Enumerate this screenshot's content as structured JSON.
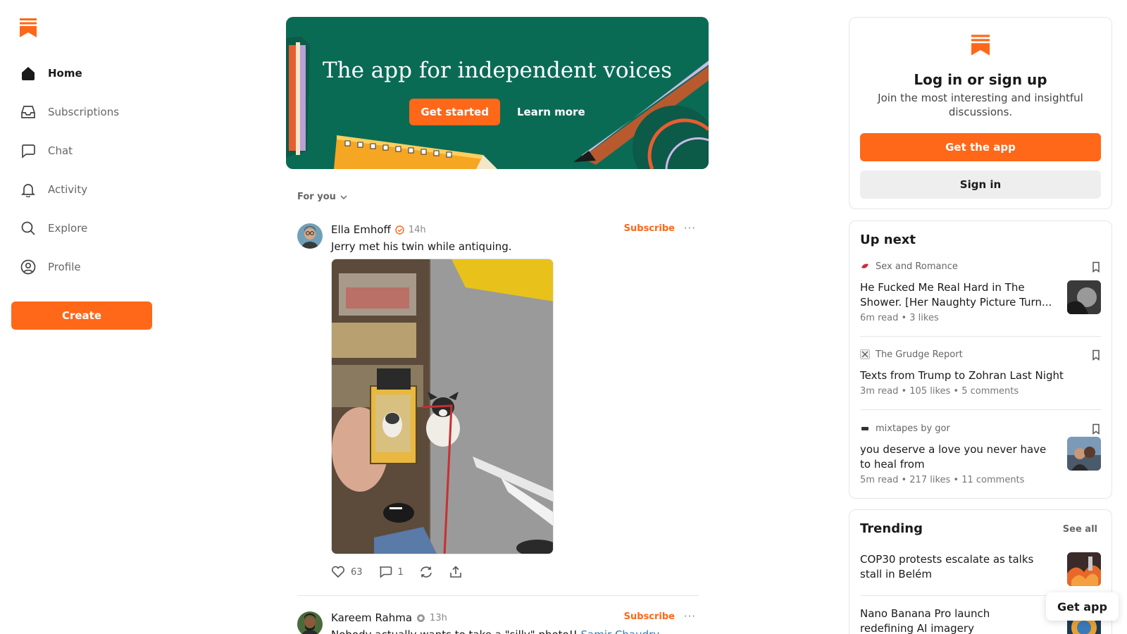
{
  "brand": {
    "accent": "#ff6719",
    "hero_bg": "#0a6b55"
  },
  "sidebar": {
    "items": [
      {
        "label": "Home",
        "icon": "home-icon",
        "active": true
      },
      {
        "label": "Subscriptions",
        "icon": "inbox-icon"
      },
      {
        "label": "Chat",
        "icon": "chat-icon"
      },
      {
        "label": "Activity",
        "icon": "bell-icon"
      },
      {
        "label": "Explore",
        "icon": "search-icon"
      },
      {
        "label": "Profile",
        "icon": "profile-icon"
      }
    ],
    "create_label": "Create"
  },
  "hero": {
    "title": "The app for independent voices",
    "primary_label": "Get started",
    "secondary_label": "Learn more"
  },
  "feed": {
    "filter_label": "For you",
    "posts": [
      {
        "author": "Ella Emhoff",
        "time": "14h",
        "subscribe_label": "Subscribe",
        "text": "Jerry met his twin while antiquing.",
        "likes": "63",
        "comments": "1"
      },
      {
        "author": "Kareem Rahma",
        "time": "13h",
        "subscribe_label": "Subscribe",
        "text": "Nobody actually wants to take a \"silly\" photo!! ",
        "mention": "Samir Chaudry"
      }
    ]
  },
  "login": {
    "title": "Log in or sign up",
    "subtitle": "Join the most interesting and insightful discussions.",
    "get_app_label": "Get the app",
    "sign_in_label": "Sign in"
  },
  "up_next": {
    "title": "Up next",
    "items": [
      {
        "publication": "Sex and Romance",
        "title": "He Fucked Me Real Hard in The Shower. [Her Naughty Picture Turn...",
        "meta": "6m read • 3 likes"
      },
      {
        "publication": "The Grudge Report",
        "title": "Texts from Trump to Zohran Last Night",
        "meta": "3m read • 105 likes • 5 comments"
      },
      {
        "publication": "mixtapes by gor",
        "title": "you deserve a love you never have to heal from",
        "meta": "5m read • 217 likes • 11 comments"
      }
    ]
  },
  "trending": {
    "title": "Trending",
    "see_all_label": "See all",
    "items": [
      {
        "title": "COP30 protests escalate as talks stall in Belém"
      },
      {
        "title": "Nano Banana Pro launch redefining AI imagery"
      }
    ]
  },
  "floating": {
    "get_app_label": "Get app"
  }
}
